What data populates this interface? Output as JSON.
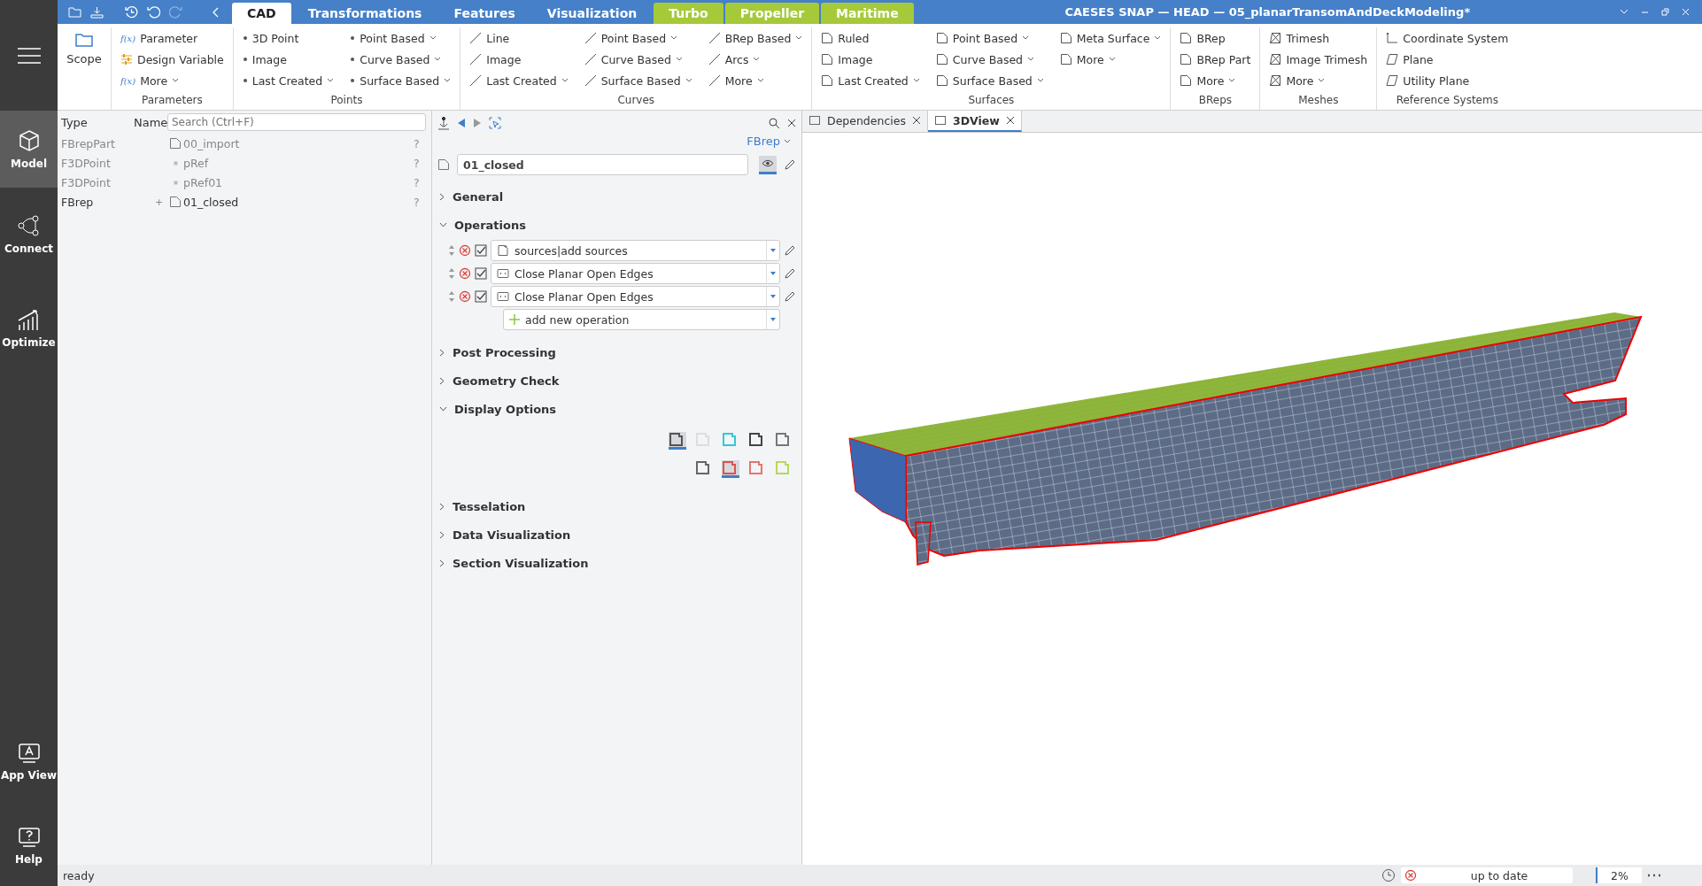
{
  "window": {
    "title": "CAESES SNAP — HEAD — 05_planarTransomAndDeckModeling*"
  },
  "sidebar": {
    "top": [
      {
        "label": "Model",
        "kind": "cube",
        "selected": true
      },
      {
        "label": "Connect",
        "kind": "graph",
        "selected": false
      },
      {
        "label": "Optimize",
        "kind": "chart",
        "selected": false
      }
    ],
    "bottom": [
      {
        "label": "App View",
        "kind": "appview",
        "selected": false
      },
      {
        "label": "Help",
        "kind": "help",
        "selected": false
      }
    ]
  },
  "ribbon_tabs": [
    {
      "label": "CAD",
      "kind": "main",
      "selected": true
    },
    {
      "label": "Transformations",
      "kind": "main",
      "selected": false
    },
    {
      "label": "Features",
      "kind": "main",
      "selected": false
    },
    {
      "label": "Visualization",
      "kind": "main",
      "selected": false
    },
    {
      "label": "Turbo",
      "kind": "app",
      "selected": false
    },
    {
      "label": "Propeller",
      "kind": "app",
      "selected": false
    },
    {
      "label": "Maritime",
      "kind": "app",
      "selected": false
    }
  ],
  "ribbon": {
    "scope": {
      "label": "Scope"
    },
    "groups": [
      {
        "title": "Parameters",
        "items": [
          {
            "label": "Parameter",
            "kind": "formula",
            "icon_text": "f(x)",
            "dropdown": false
          },
          {
            "label": "Design Variable",
            "kind": "sliders",
            "dropdown": false
          },
          {
            "label": "More",
            "kind": "formula",
            "icon_text": "f(x)",
            "dropdown": true
          }
        ]
      },
      {
        "title": "Points",
        "items": [
          {
            "label": "3D Point",
            "kind": "dot",
            "dropdown": false
          },
          {
            "label": "Image",
            "kind": "dot",
            "dropdown": false
          },
          {
            "label": "Last Created",
            "kind": "dot",
            "dropdown": true
          },
          {
            "label": "Point Based",
            "kind": "dot",
            "dropdown": true
          },
          {
            "label": "Curve Based",
            "kind": "dot",
            "dropdown": true
          },
          {
            "label": "Surface Based",
            "kind": "dot",
            "dropdown": true
          }
        ]
      },
      {
        "title": "Curves",
        "items": [
          {
            "label": "Line",
            "kind": "line",
            "dropdown": false
          },
          {
            "label": "Image",
            "kind": "line",
            "dropdown": false
          },
          {
            "label": "Last Created",
            "kind": "line",
            "dropdown": true
          },
          {
            "label": "Point Based",
            "kind": "line",
            "dropdown": true
          },
          {
            "label": "Curve Based",
            "kind": "line",
            "dropdown": true
          },
          {
            "label": "Surface Based",
            "kind": "line",
            "dropdown": true
          },
          {
            "label": "BRep Based",
            "kind": "line",
            "dropdown": true
          },
          {
            "label": "Arcs",
            "kind": "line",
            "dropdown": true
          },
          {
            "label": "More",
            "kind": "line",
            "dropdown": true
          }
        ]
      },
      {
        "title": "Surfaces",
        "items": [
          {
            "label": "Ruled",
            "kind": "surface",
            "dropdown": false
          },
          {
            "label": "Image",
            "kind": "surface",
            "dropdown": false
          },
          {
            "label": "Last Created",
            "kind": "surface",
            "dropdown": true
          },
          {
            "label": "Point Based",
            "kind": "surface",
            "dropdown": true
          },
          {
            "label": "Curve Based",
            "kind": "surface",
            "dropdown": true
          },
          {
            "label": "Surface Based",
            "kind": "surface",
            "dropdown": true
          },
          {
            "label": "Meta Surface",
            "kind": "surface",
            "dropdown": true
          },
          {
            "label": "More",
            "kind": "surface",
            "dropdown": true
          }
        ]
      },
      {
        "title": "BReps",
        "items": [
          {
            "label": "BRep",
            "kind": "surface",
            "dropdown": false
          },
          {
            "label": "BRep Part",
            "kind": "surface",
            "dropdown": false
          },
          {
            "label": "More",
            "kind": "surface",
            "dropdown": true
          }
        ]
      },
      {
        "title": "Meshes",
        "items": [
          {
            "label": "Trimesh",
            "kind": "mesh",
            "dropdown": false
          },
          {
            "label": "Image Trimesh",
            "kind": "mesh",
            "dropdown": false
          },
          {
            "label": "More",
            "kind": "mesh",
            "dropdown": true
          }
        ]
      },
      {
        "title": "Reference Systems",
        "items": [
          {
            "label": "Coordinate System",
            "kind": "axes",
            "dropdown": false
          },
          {
            "label": "Plane",
            "kind": "plane",
            "dropdown": false
          },
          {
            "label": "Utility Plane",
            "kind": "plane",
            "dropdown": false
          }
        ]
      }
    ]
  },
  "tree": {
    "columns": [
      "Type",
      "Name"
    ],
    "search": {
      "placeholder": "Search (Ctrl+F)"
    },
    "rows": [
      {
        "type": "FBrepPart",
        "name": "00_import",
        "kind": "part",
        "dimmed": true,
        "status": "?"
      },
      {
        "type": "F3DPoint",
        "name": "pRef",
        "kind": "point",
        "dimmed": true,
        "status": "?"
      },
      {
        "type": "F3DPoint",
        "name": "pRef01",
        "kind": "point",
        "dimmed": true,
        "status": "?"
      },
      {
        "type": "FBrep",
        "name": "01_closed",
        "kind": "part",
        "dimmed": false,
        "expander": "+",
        "status": "?"
      }
    ]
  },
  "properties": {
    "type_selector": "FBrep",
    "name_field": "01_closed",
    "sections": [
      {
        "label": "General",
        "expanded": false
      },
      {
        "label": "Operations",
        "expanded": true,
        "operations": [
          {
            "label": "sources|add sources",
            "kind": "source",
            "enabled": true
          },
          {
            "label": "Close Planar Open Edges",
            "kind": "function",
            "enabled": true
          },
          {
            "label": "Close Planar Open Edges",
            "kind": "function",
            "enabled": true
          }
        ],
        "add_operation": "add new operation"
      },
      {
        "label": "Post Processing",
        "expanded": false
      },
      {
        "label": "Geometry Check",
        "expanded": false
      },
      {
        "label": "Display Options",
        "expanded": true,
        "display_buttons": [
          [
            {
              "color": "#555555",
              "selected": true
            },
            {
              "color": "#dddddd",
              "selected": false
            },
            {
              "color": "#33c8d8",
              "selected": false
            },
            {
              "color": "#444444",
              "selected": false
            },
            {
              "color": "#777777",
              "selected": false
            }
          ],
          [
            {
              "color": "#666666",
              "selected": false
            },
            {
              "color": "#d9534f",
              "selected": true
            },
            {
              "color": "#e8736b",
              "selected": false
            },
            {
              "color": "#b5d85a",
              "selected": false
            }
          ]
        ]
      },
      {
        "label": "Tesselation",
        "expanded": false
      },
      {
        "label": "Data Visualization",
        "expanded": false
      },
      {
        "label": "Section Visualization",
        "expanded": false
      }
    ]
  },
  "viewer_tabs": [
    {
      "label": "Dependencies",
      "selected": false
    },
    {
      "label": "3DView",
      "selected": true
    }
  ],
  "status_bar": {
    "message": "ready",
    "state": "up to date",
    "progress": "2%"
  }
}
